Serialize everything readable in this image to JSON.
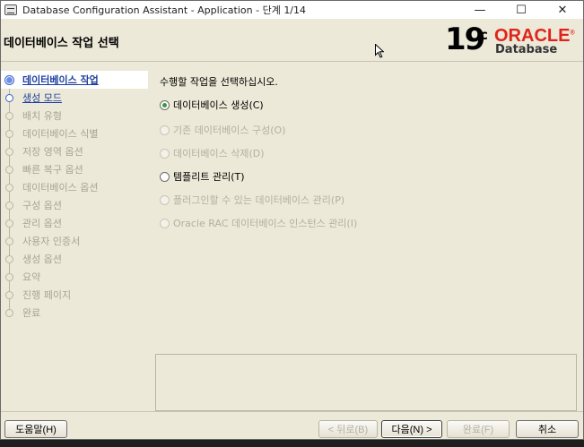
{
  "window": {
    "title": "Database Configuration Assistant - Application - 단계 1/14",
    "controls": {
      "minimize": "—",
      "maximize": "☐",
      "close": "✕"
    }
  },
  "header": {
    "page_title": "데이터베이스 작업 선택",
    "brand": {
      "version": "19",
      "version_sup": "c",
      "oracle": "ORACLE",
      "registered": "®",
      "product": "Database"
    }
  },
  "sidebar": {
    "steps": [
      {
        "label": "데이터베이스 작업",
        "state": "active"
      },
      {
        "label": "생성 모드",
        "state": "next"
      },
      {
        "label": "배치 유형",
        "state": "disabled"
      },
      {
        "label": "데이터베이스 식별",
        "state": "disabled"
      },
      {
        "label": "저장 영역 옵션",
        "state": "disabled"
      },
      {
        "label": "빠른 복구 옵션",
        "state": "disabled"
      },
      {
        "label": "데이터베이스 옵션",
        "state": "disabled"
      },
      {
        "label": "구성 옵션",
        "state": "disabled"
      },
      {
        "label": "관리 옵션",
        "state": "disabled"
      },
      {
        "label": "사용자 인증서",
        "state": "disabled"
      },
      {
        "label": "생성 옵션",
        "state": "disabled"
      },
      {
        "label": "요약",
        "state": "disabled"
      },
      {
        "label": "진행 페이지",
        "state": "disabled"
      },
      {
        "label": "완료",
        "state": "disabled"
      }
    ]
  },
  "content": {
    "instruction": "수행할 작업을 선택하십시오.",
    "options": [
      {
        "label": "데이터베이스 생성(C)",
        "checked": true,
        "enabled": true
      },
      {
        "label": "기존 데이터베이스 구성(O)",
        "checked": false,
        "enabled": false
      },
      {
        "label": "데이터베이스 삭제(D)",
        "checked": false,
        "enabled": false
      },
      {
        "label": "템플리트 관리(T)",
        "checked": false,
        "enabled": true
      },
      {
        "label": "플러그인할 수 있는 데이터베이스 관리(P)",
        "checked": false,
        "enabled": false
      },
      {
        "label": "Oracle RAC 데이터베이스 인스턴스 관리(I)",
        "checked": false,
        "enabled": false
      }
    ]
  },
  "footer": {
    "help": "도움말(H)",
    "back": "< 뒤로(B)",
    "next": "다음(N) >",
    "finish": "완료(F)",
    "cancel": "취소"
  }
}
